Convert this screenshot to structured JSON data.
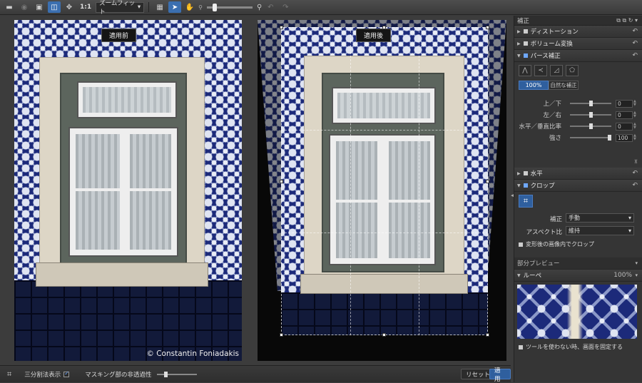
{
  "toolbar": {
    "ratio_label": "1:1",
    "zoom_select": "ズームフィット",
    "icons": [
      "folder-icon",
      "save-icon",
      "single-view-icon",
      "split-view-icon",
      "move-icon",
      "grid-icon",
      "select-arrow-icon",
      "hand-icon",
      "zoom-out-icon",
      "zoom-in-icon",
      "undo-icon",
      "redo-icon"
    ]
  },
  "viewer": {
    "before_label": "適用前",
    "after_label": "適用後",
    "copyright": "© Constantin Foniadakis"
  },
  "bottombar": {
    "thirds_label": "三分割法表示",
    "thirds_checked": true,
    "mask_label": "マスキング部の非透過性",
    "reset_label": "リセット",
    "apply_label": "適用"
  },
  "sidebar": {
    "title": "補正",
    "sections": {
      "distortion": "ディストーション",
      "volume": "ボリューム変換",
      "perspective": "パース補正",
      "horizontal": "水平",
      "crop": "クロップ"
    },
    "perspective": {
      "mode_selected": "100%",
      "mode_natural": "自然な補正",
      "sliders": [
        {
          "label": "上／下",
          "value": "0",
          "pos": 0.5
        },
        {
          "label": "左／右",
          "value": "0",
          "pos": 0.5
        },
        {
          "label": "水平／垂直比率",
          "value": "0",
          "pos": 0.5
        },
        {
          "label": "強さ",
          "value": "100",
          "pos": 1.0
        }
      ]
    },
    "crop": {
      "correction_label": "補正",
      "correction_value": "手動",
      "aspect_label": "アスペクト比",
      "aspect_value": "維持",
      "crop_inside_label": "変形後の画像内でクロップ"
    },
    "preview": {
      "title": "部分プレビュー",
      "loupe_label": "ルーペ",
      "zoom": "100%",
      "fix_screen_label": "ツールを使わない時、画面を固定する"
    }
  }
}
